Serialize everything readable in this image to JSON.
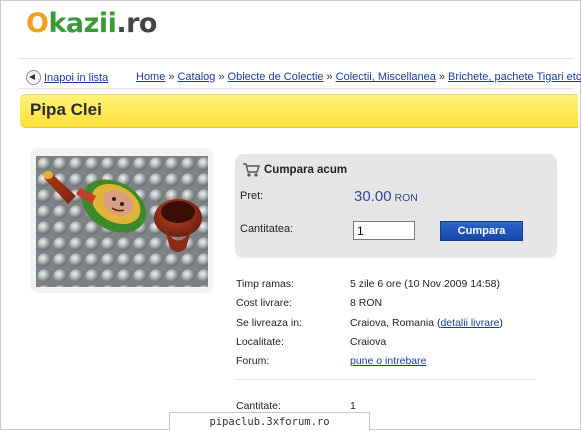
{
  "site": {
    "logo_text": "Okazii.ro",
    "logo_colors": [
      "#f0a020",
      "#3a9a3a",
      "#444444"
    ]
  },
  "nav": {
    "back_label": "Inapoi in lista",
    "breadcrumbs": [
      "Home",
      "Catalog",
      "Obiecte de Colectie",
      "Colectii, Miscellanea",
      "Brichete, pachete Tigari etc"
    ],
    "separator": "»"
  },
  "product": {
    "title": "Pipa Clei",
    "photo_alt": "pipe on bubble wrap"
  },
  "buy_box": {
    "title": "Cumpara acum",
    "price_label": "Pret:",
    "price_value": "30.00",
    "currency": "RON",
    "quantity_label": "Cantitatea:",
    "quantity_value": "1",
    "buy_button": "Cumpara"
  },
  "details": {
    "time_left_label": "Timp ramas:",
    "time_left_value": "5 zile 6 ore (10 Nov 2009 14:58)",
    "shipping_cost_label": "Cost livrare:",
    "shipping_cost_value": "8 RON",
    "delivered_in_label": "Se livreaza in:",
    "delivered_in_value": "Craiova, Romania",
    "delivery_link_open": "(",
    "delivery_link": "detalii livrare",
    "delivery_link_close": ")",
    "locality_label": "Localitate:",
    "locality_value": "Craiova",
    "forum_label": "Forum:",
    "forum_link": "pune o intrebare",
    "quantity_label": "Cantitate:",
    "quantity_value": "1"
  },
  "watermark": "pipaclub.3xforum.ro",
  "colors": {
    "title_bar": "#ffe13a",
    "button": "#1747a8",
    "link": "#1a3d9a",
    "price": "#2a4a8a"
  }
}
